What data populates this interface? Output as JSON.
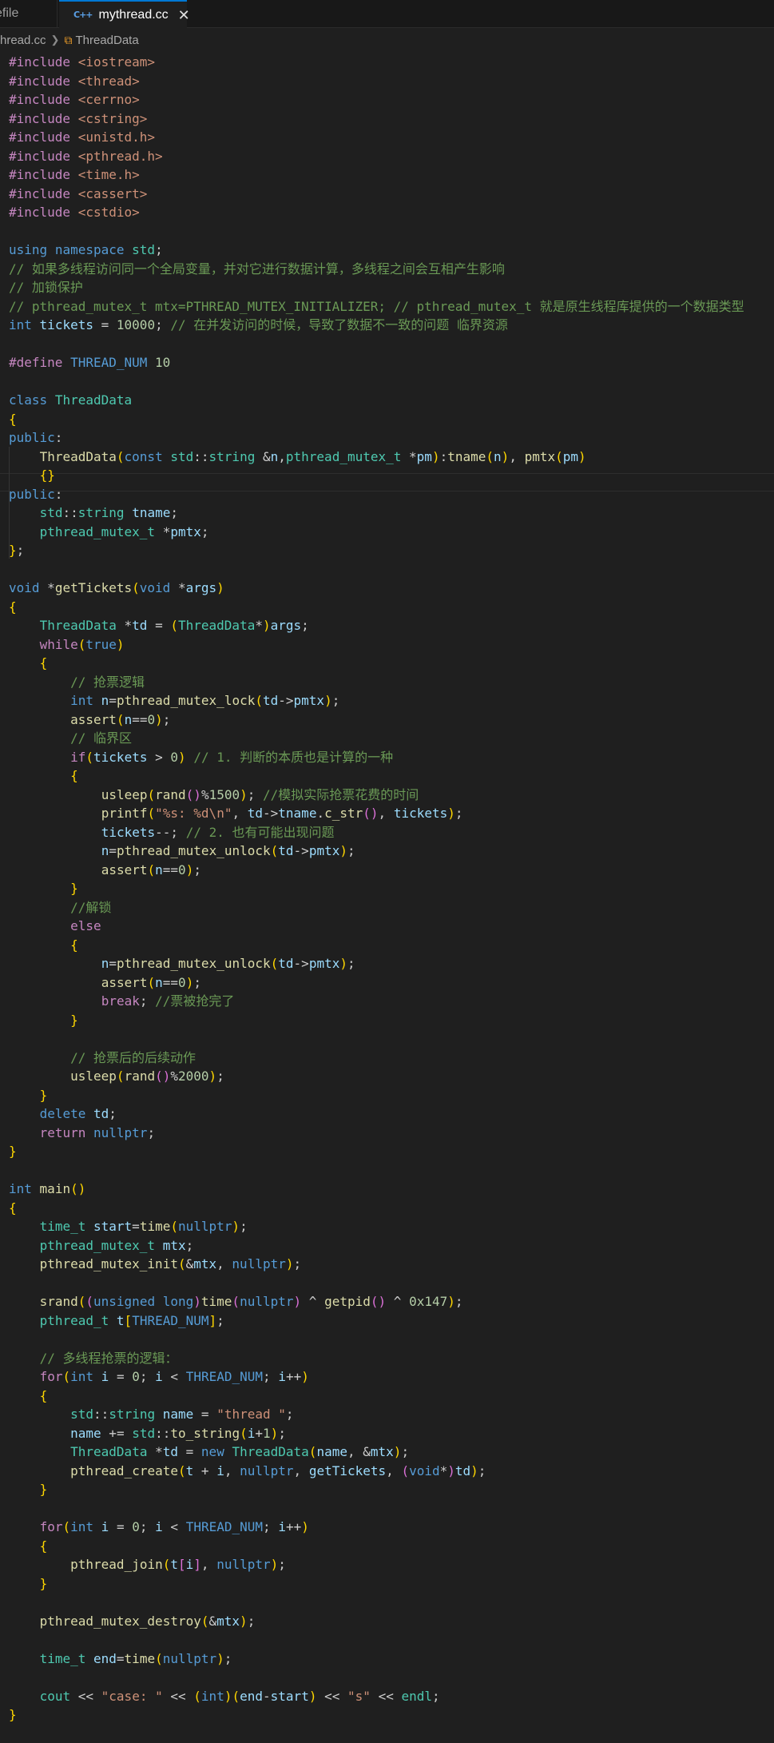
{
  "tabs": {
    "inactive_label": "efile",
    "active_label": "mythread.cc",
    "active_icon": "C++"
  },
  "breadcrumb": {
    "file": "hread.cc",
    "symbol": "ThreadData"
  },
  "colors": {
    "background": "#1f1f1f",
    "keyword": "#569cd6",
    "type": "#4ec9b0",
    "function": "#dcdcaa",
    "variable": "#9cdcfe",
    "string": "#ce9178",
    "comment": "#6a9955",
    "preprocessor": "#c586c0",
    "accent": "#0078d4"
  },
  "code_lines": [
    "#include <iostream>",
    "#include <thread>",
    "#include <cerrno>",
    "#include <cstring>",
    "#include <unistd.h>",
    "#include <pthread.h>",
    "#include <time.h>",
    "#include <cassert>",
    "#include <cstdio>",
    "",
    "using namespace std;",
    "// 如果多线程访问同一个全局变量，并对它进行数据计算，多线程之间会互相产生影响",
    "// 加锁保护",
    "// pthread_mutex_t mtx=PTHREAD_MUTEX_INITIALIZER; // pthread_mutex_t 就是原生线程库提供的一个数据类型",
    "int tickets = 10000; // 在并发访问的时候，导致了数据不一致的问题 临界资源",
    "",
    "#define THREAD_NUM 10",
    "",
    "class ThreadData",
    "{",
    "public:",
    "    ThreadData(const std::string &n,pthread_mutex_t *pm):tname(n), pmtx(pm)",
    "    {}",
    "public:",
    "    std::string tname;",
    "    pthread_mutex_t *pmtx;",
    "};",
    "",
    "void *getTickets(void *args)",
    "{",
    "    ThreadData *td = (ThreadData*)args;",
    "    while(true)",
    "    {",
    "        // 抢票逻辑",
    "        int n=pthread_mutex_lock(td->pmtx);",
    "        assert(n==0);",
    "        // 临界区",
    "        if(tickets > 0) // 1. 判断的本质也是计算的一种",
    "        {",
    "            usleep(rand()%1500); //模拟实际抢票花费的时间",
    "            printf(\"%s: %d\\n\", td->tname.c_str(), tickets);",
    "            tickets--; // 2. 也有可能出现问题",
    "            n=pthread_mutex_unlock(td->pmtx);",
    "            assert(n==0);",
    "        }",
    "        //解锁",
    "        else",
    "        {",
    "            n=pthread_mutex_unlock(td->pmtx);",
    "            assert(n==0);",
    "            break; //票被抢完了",
    "        }",
    "",
    "        // 抢票后的后续动作",
    "        usleep(rand()%2000);",
    "    }",
    "    delete td;",
    "    return nullptr;",
    "}",
    "",
    "int main()",
    "{",
    "    time_t start=time(nullptr);",
    "    pthread_mutex_t mtx;",
    "    pthread_mutex_init(&mtx, nullptr);",
    "",
    "    srand((unsigned long)time(nullptr) ^ getpid() ^ 0x147);",
    "    pthread_t t[THREAD_NUM];",
    "",
    "    // 多线程抢票的逻辑：",
    "    for(int i = 0; i < THREAD_NUM; i++)",
    "    {",
    "        std::string name = \"thread \";",
    "        name += std::to_string(i+1);",
    "        ThreadData *td = new ThreadData(name, &mtx);",
    "        pthread_create(t + i, nullptr, getTickets, (void*)td);",
    "    }",
    "",
    "    for(int i = 0; i < THREAD_NUM; i++)",
    "    {",
    "        pthread_join(t[i], nullptr);",
    "    }",
    "",
    "    pthread_mutex_destroy(&mtx);",
    "",
    "    time_t end=time(nullptr);",
    "",
    "    cout << \"case: \" << (int)(end-start) << \"s\" << endl;",
    "}"
  ]
}
